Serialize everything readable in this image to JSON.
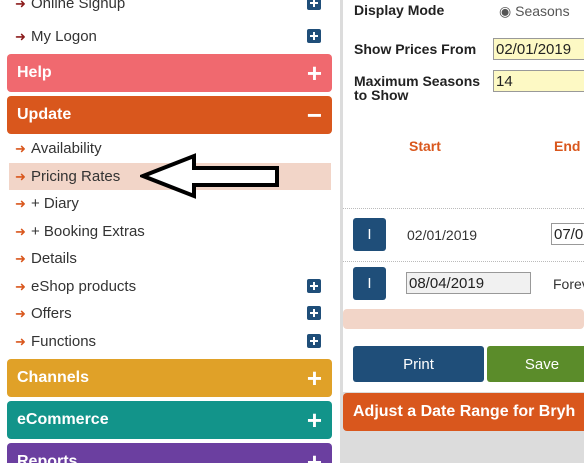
{
  "sidebar": {
    "top_partial": {
      "label": "Online Signup"
    },
    "my_logon": {
      "label": "My Logon"
    },
    "help": {
      "label": "Help",
      "toggle": "+",
      "color": "#f0696f"
    },
    "update": {
      "label": "Update",
      "toggle": "−",
      "color": "#d9571d"
    },
    "update_items": [
      {
        "label": "Availability"
      },
      {
        "label": "Pricing Rates"
      },
      {
        "label": "+ Diary"
      },
      {
        "label": "+ Booking Extras"
      },
      {
        "label": "Details"
      },
      {
        "label": "eShop products"
      },
      {
        "label": "Offers"
      },
      {
        "label": "Functions"
      }
    ],
    "channels": {
      "label": "Channels",
      "toggle": "+",
      "color": "#e0a128"
    },
    "ecommerce": {
      "label": "eCommerce",
      "toggle": "+",
      "color": "#12948a"
    },
    "reports": {
      "label": "Reports",
      "toggle": "+",
      "color": "#6b3fa0"
    }
  },
  "main": {
    "display_mode": {
      "label": "Display Mode",
      "value": "Seasons"
    },
    "show_prices_from": {
      "label": "Show Prices From",
      "value": "02/01/2019"
    },
    "max_seasons": {
      "label_line1": "Maximum Seasons",
      "label_line2": "to Show",
      "value": "14"
    },
    "columns": {
      "start": "Start",
      "end": "End"
    },
    "rows": [
      {
        "info": "I",
        "start": "02/01/2019",
        "end": "07/0"
      },
      {
        "info": "I",
        "start": "08/04/2019",
        "end": "Forev"
      }
    ],
    "print_label": "Print",
    "save_label": "Save"
  },
  "date_range_bar": {
    "label": "Adjust a Date Range for Bryh"
  },
  "colors": {
    "accent_orange": "#d9571d",
    "navy": "#1f4e79",
    "green": "#5b8c2a",
    "highlight": "#f2d5c8"
  }
}
